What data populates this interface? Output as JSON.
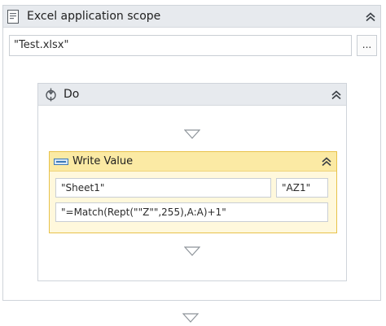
{
  "scope": {
    "title": "Excel application scope",
    "workbook_path": "\"Test.xlsx\"",
    "browse_label": "..."
  },
  "do_sequence": {
    "title": "Do"
  },
  "write_value": {
    "title": "Write Value",
    "sheet_name": "\"Sheet1\"",
    "cell": "\"AZ1\"",
    "value": "\"=Match(Rept(\"\"Z\"\",255),A:A)+1\""
  },
  "colors": {
    "header_bg": "#e7eaee",
    "activity_accent": "#e8c24a",
    "activity_header_bg": "#fbeaa4",
    "activity_body_bg": "#fff8dc",
    "border": "#cfd4da"
  },
  "icons": {
    "scope": "excel-scope-icon",
    "sequence": "sequence-icon",
    "write_value": "write-value-icon",
    "collapse": "double-chevron-up-icon",
    "drop_target": "drop-arrow-icon"
  }
}
